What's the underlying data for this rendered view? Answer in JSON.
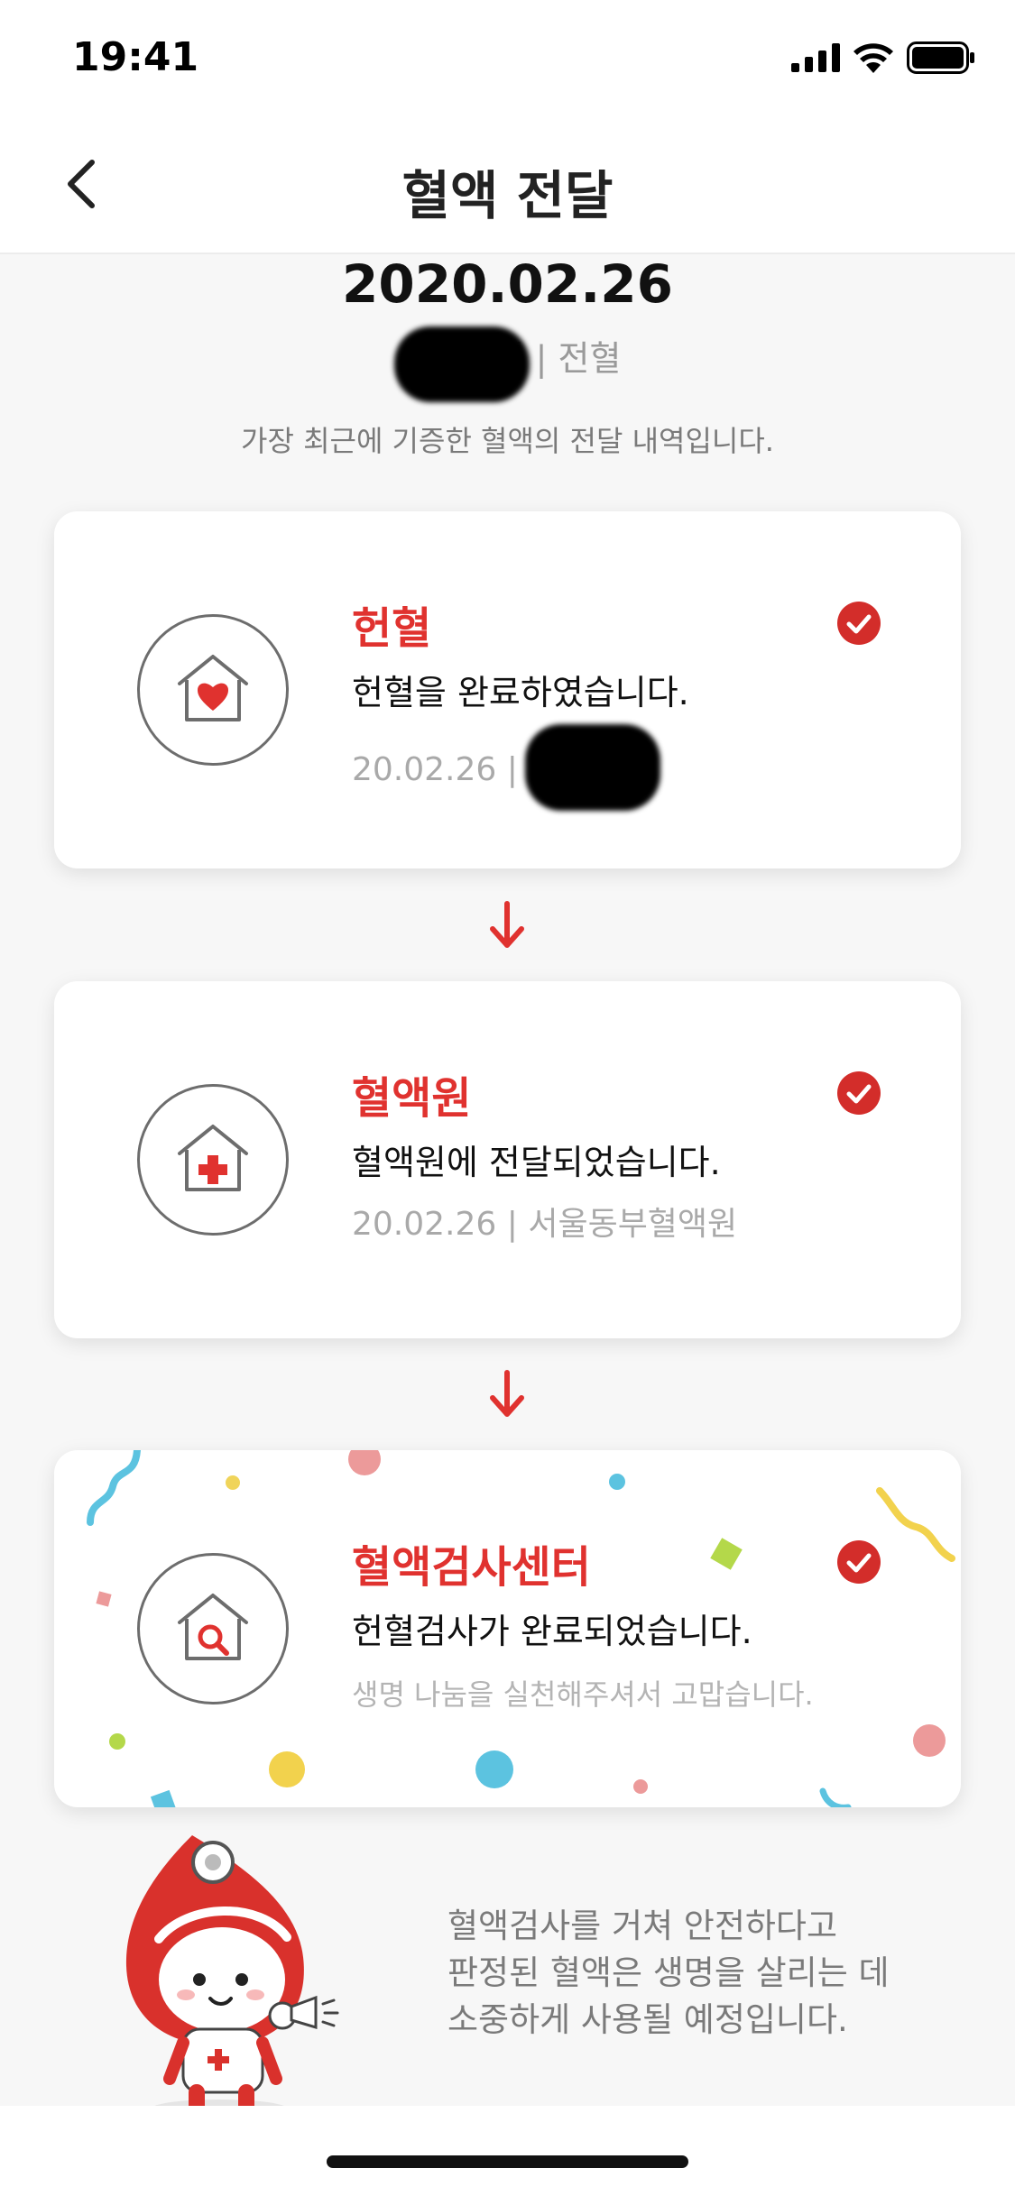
{
  "status_bar": {
    "time": "19:41"
  },
  "nav": {
    "title": "혈액 전달"
  },
  "header": {
    "date": "2020.02.26",
    "sub_suffix": "| 전혈",
    "sub_partial": "혈",
    "description": "가장 최근에 기증한 혈액의 전달 내역입니다."
  },
  "steps": [
    {
      "title": "헌혈",
      "text": "헌혈을 완료하였습니다.",
      "meta": "20.02.26 |",
      "icon": "house-heart-icon"
    },
    {
      "title": "혈액원",
      "text": "혈액원에 전달되었습니다.",
      "meta": "20.02.26 | 서울동부혈액원",
      "icon": "house-cross-icon"
    },
    {
      "title": "혈액검사센터",
      "text": "헌혈검사가 완료되었습니다.",
      "meta": "생명 나눔을 실천해주셔서 고맙습니다.",
      "icon": "house-magnifier-icon"
    }
  ],
  "footer": {
    "lines": [
      "혈액검사를 거쳐 안전하다고",
      "판정된 혈액은 생명을 살리는 데",
      "소중하게 사용될 예정입니다."
    ]
  },
  "colors": {
    "accent": "#e0322f",
    "background": "#f7f7f7",
    "card": "#ffffff"
  }
}
